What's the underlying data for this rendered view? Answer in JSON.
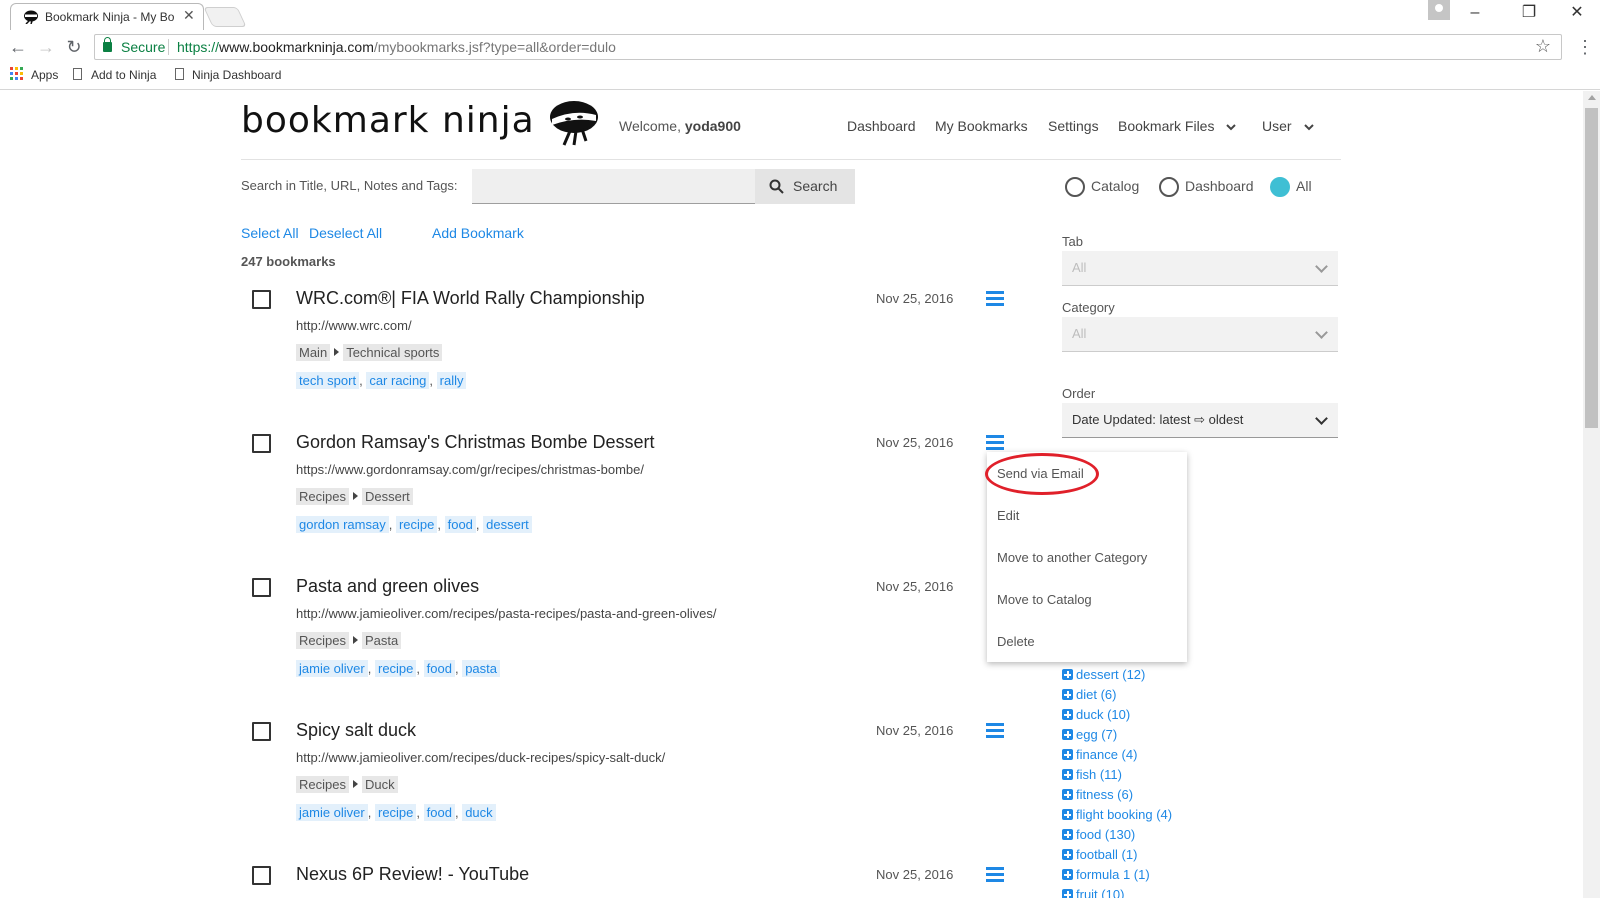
{
  "browser": {
    "tab_title": "Bookmark Ninja - My Bo",
    "secure_label": "Secure",
    "url_scheme": "https://",
    "url_host": "www.bookmarkninja.com",
    "url_path": "/mybookmarks.jsf?type=all&order=dulo",
    "bookmarks_bar": [
      "Apps",
      "Add to Ninja",
      "Ninja Dashboard"
    ]
  },
  "header": {
    "logo_text": "bookmark ninja",
    "welcome_prefix": "Welcome, ",
    "username": "yoda900",
    "nav": [
      "Dashboard",
      "My Bookmarks",
      "Settings",
      "Bookmark Files",
      "User"
    ]
  },
  "search": {
    "label": "Search in Title, URL, Notes and Tags:",
    "input_value": "",
    "button_label": "Search",
    "scope_options": [
      "Catalog",
      "Dashboard",
      "All"
    ],
    "selected_scope": "All"
  },
  "actions": {
    "select_all": "Select All",
    "deselect_all": "Deselect All",
    "add_bookmark": "Add Bookmark",
    "count_label": "247 bookmarks"
  },
  "bookmarks": [
    {
      "title": "WRC.com®| FIA World Rally Championship",
      "date": "Nov 25, 2016",
      "url": "http://www.wrc.com/",
      "path": [
        "Main",
        "Technical sports"
      ],
      "tags": [
        "tech sport",
        "car racing",
        "rally"
      ]
    },
    {
      "title": "Gordon Ramsay's Christmas Bombe Dessert",
      "date": "Nov 25, 2016",
      "url": "https://www.gordonramsay.com/gr/recipes/christmas-bombe/",
      "path": [
        "Recipes",
        "Dessert"
      ],
      "tags": [
        "gordon ramsay",
        "recipe",
        "food",
        "dessert"
      ]
    },
    {
      "title": "Pasta and green olives",
      "date": "Nov 25, 2016",
      "url": "http://www.jamieoliver.com/recipes/pasta-recipes/pasta-and-green-olives/",
      "path": [
        "Recipes",
        "Pasta"
      ],
      "tags": [
        "jamie oliver",
        "recipe",
        "food",
        "pasta"
      ]
    },
    {
      "title": "Spicy salt duck",
      "date": "Nov 25, 2016",
      "url": "http://www.jamieoliver.com/recipes/duck-recipes/spicy-salt-duck/",
      "path": [
        "Recipes",
        "Duck"
      ],
      "tags": [
        "jamie oliver",
        "recipe",
        "food",
        "duck"
      ]
    },
    {
      "title": "Nexus 6P Review! - YouTube",
      "date": "Nov 25, 2016",
      "url": "",
      "path": [],
      "tags": []
    }
  ],
  "filters": {
    "tab_label": "Tab",
    "tab_value": "All",
    "category_label": "Category",
    "category_value": "All",
    "order_label": "Order",
    "order_value": "Date Updated: latest ⇨ oldest"
  },
  "context_menu": [
    "Send via Email",
    "Edit",
    "Move to another Category",
    "Move to Catalog",
    "Delete"
  ],
  "tag_cloud": [
    "dessert (12)",
    "diet (6)",
    "duck (10)",
    "egg (7)",
    "finance (4)",
    "fish (11)",
    "fitness (6)",
    "flight booking (4)",
    "food (130)",
    "football (1)",
    "formula 1 (1)",
    "fruit (10)"
  ],
  "colors": {
    "link": "#1e88e5",
    "radio_selected": "#3fbfd4",
    "highlight_ellipse": "#e0202a",
    "secure_green": "#0b8043"
  }
}
